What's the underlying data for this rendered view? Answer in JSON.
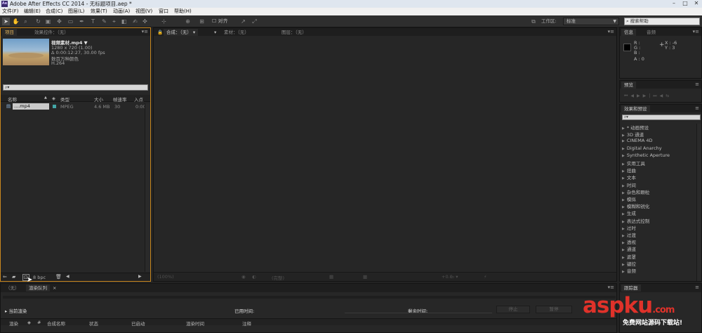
{
  "window": {
    "title": "Adobe After Effects CC 2014 - 无标题项目.aep *",
    "app_badge": "Ae",
    "min": "–",
    "max": "□",
    "close": "✕"
  },
  "menu": [
    "文件(F)",
    "编辑(E)",
    "合成(C)",
    "图层(L)",
    "效果(T)",
    "动画(A)",
    "视图(V)",
    "窗口",
    "帮助(H)"
  ],
  "toolbar": {
    "align_label": "对齐",
    "workspace_label": "工作区:",
    "workspace_value": "标准",
    "search_help": "搜索帮助"
  },
  "project_panel": {
    "tab_project": "项目",
    "tab_effect_controls": "效果控件：（无）",
    "file_name": "视频素材.mp4 ▼",
    "file_info": [
      "1280 x 720 (1.00)",
      "Δ 0:00:12:27, 30.00 fps",
      "数百万种颜色",
      "H.264"
    ],
    "search_glyph": "⌕▾",
    "columns": [
      "名称",
      "类型",
      "大小",
      "帧速率",
      "入点"
    ],
    "rows": [
      {
        "name": "....mp4",
        "type": "MPEG",
        "size": "4.6 MB",
        "fps": "30",
        "inpoint": "0:00"
      }
    ],
    "bpc": "8 bpc"
  },
  "viewer": {
    "tab_comp": "合成：（无）",
    "tab_footage": "素材：（无）",
    "tab_layer": "图层：（无）",
    "bottom_zoom": "(100%)",
    "bottom_res": "(完整)",
    "bottom_offset": "+0.0"
  },
  "info_panel": {
    "tab_info": "信息",
    "tab_audio": "音频",
    "r": "R :",
    "g": "G :",
    "b": "B :",
    "a": "A : 0",
    "x": "X : -6",
    "y": "Y : 3"
  },
  "preview_panel": {
    "tab": "预览"
  },
  "effects_panel": {
    "tab": "效果和预设",
    "items": [
      "* 动画预设",
      "3D 通道",
      "CINEMA 4D",
      "Digital Anarchy",
      "Synthetic Aperture",
      "实用工具",
      "扭曲",
      "文本",
      "时间",
      "杂色和颗粒",
      "模拟",
      "模糊和锐化",
      "生成",
      "表达式控制",
      "过时",
      "过渡",
      "透视",
      "通道",
      "遮罩",
      "键控",
      "音频"
    ]
  },
  "timeline": {
    "tab_none": "（无）",
    "tab_render_queue": "渲染队列",
    "current_render": "当前渲染",
    "elapsed": "已用时间:",
    "remaining": "剩余时间:",
    "stop": "停止",
    "pause": "暂停",
    "columns": [
      "渲染",
      "#",
      "合成名称",
      "状态",
      "已启动",
      "渲染时间",
      "注释"
    ]
  },
  "tracker_panel": {
    "tab": "跟踪器"
  },
  "watermark": {
    "brand": "aspku",
    "tld": ".com",
    "slogan": "免费网站源码下载站!"
  },
  "colors": {
    "panel_bg": "#272727",
    "accent_orange": "#e9a23b",
    "watermark_red": "#e0322a"
  }
}
